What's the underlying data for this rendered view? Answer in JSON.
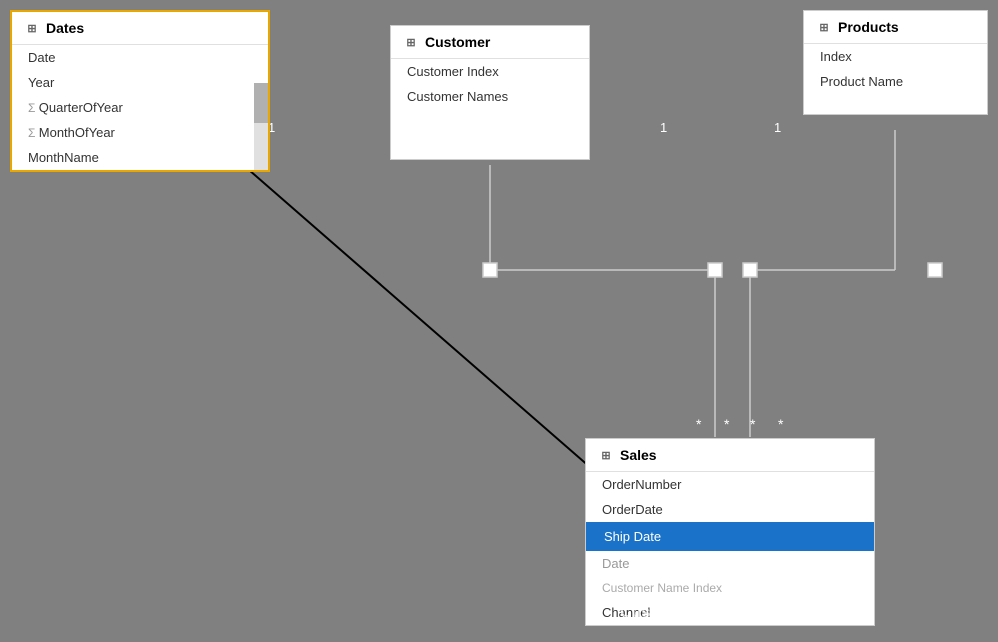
{
  "tables": {
    "dates": {
      "title": "Dates",
      "icon": "⊞",
      "fields": [
        {
          "label": "Date",
          "type": "normal",
          "selected": false
        },
        {
          "label": "Year",
          "type": "normal"
        },
        {
          "label": "QuarterOfYear",
          "type": "sigma"
        },
        {
          "label": "MonthOfYear",
          "type": "sigma"
        },
        {
          "label": "MonthName",
          "type": "normal"
        }
      ]
    },
    "customer": {
      "title": "Customer",
      "icon": "⊞",
      "fields": [
        {
          "label": "Customer Index",
          "type": "normal"
        },
        {
          "label": "Customer Names",
          "type": "normal"
        }
      ]
    },
    "products": {
      "title": "Products",
      "icon": "⊞",
      "fields": [
        {
          "label": "Index",
          "type": "normal"
        },
        {
          "label": "Product Name",
          "type": "normal"
        }
      ]
    },
    "sales": {
      "title": "Sales",
      "icon": "⊞",
      "fields": [
        {
          "label": "OrderNumber",
          "type": "normal"
        },
        {
          "label": "OrderDate",
          "type": "normal"
        },
        {
          "label": "Ship Date",
          "type": "normal",
          "selected": true
        },
        {
          "label": "Date",
          "type": "normal",
          "partial": true
        },
        {
          "label": "Customer Name Index",
          "type": "normal",
          "partial": true
        },
        {
          "label": "Channel",
          "type": "normal"
        }
      ]
    }
  },
  "relationships": {
    "one_labels": [
      "1",
      "1",
      "1"
    ],
    "asterisk_labels": [
      "*",
      "*",
      "*",
      "*"
    ]
  }
}
